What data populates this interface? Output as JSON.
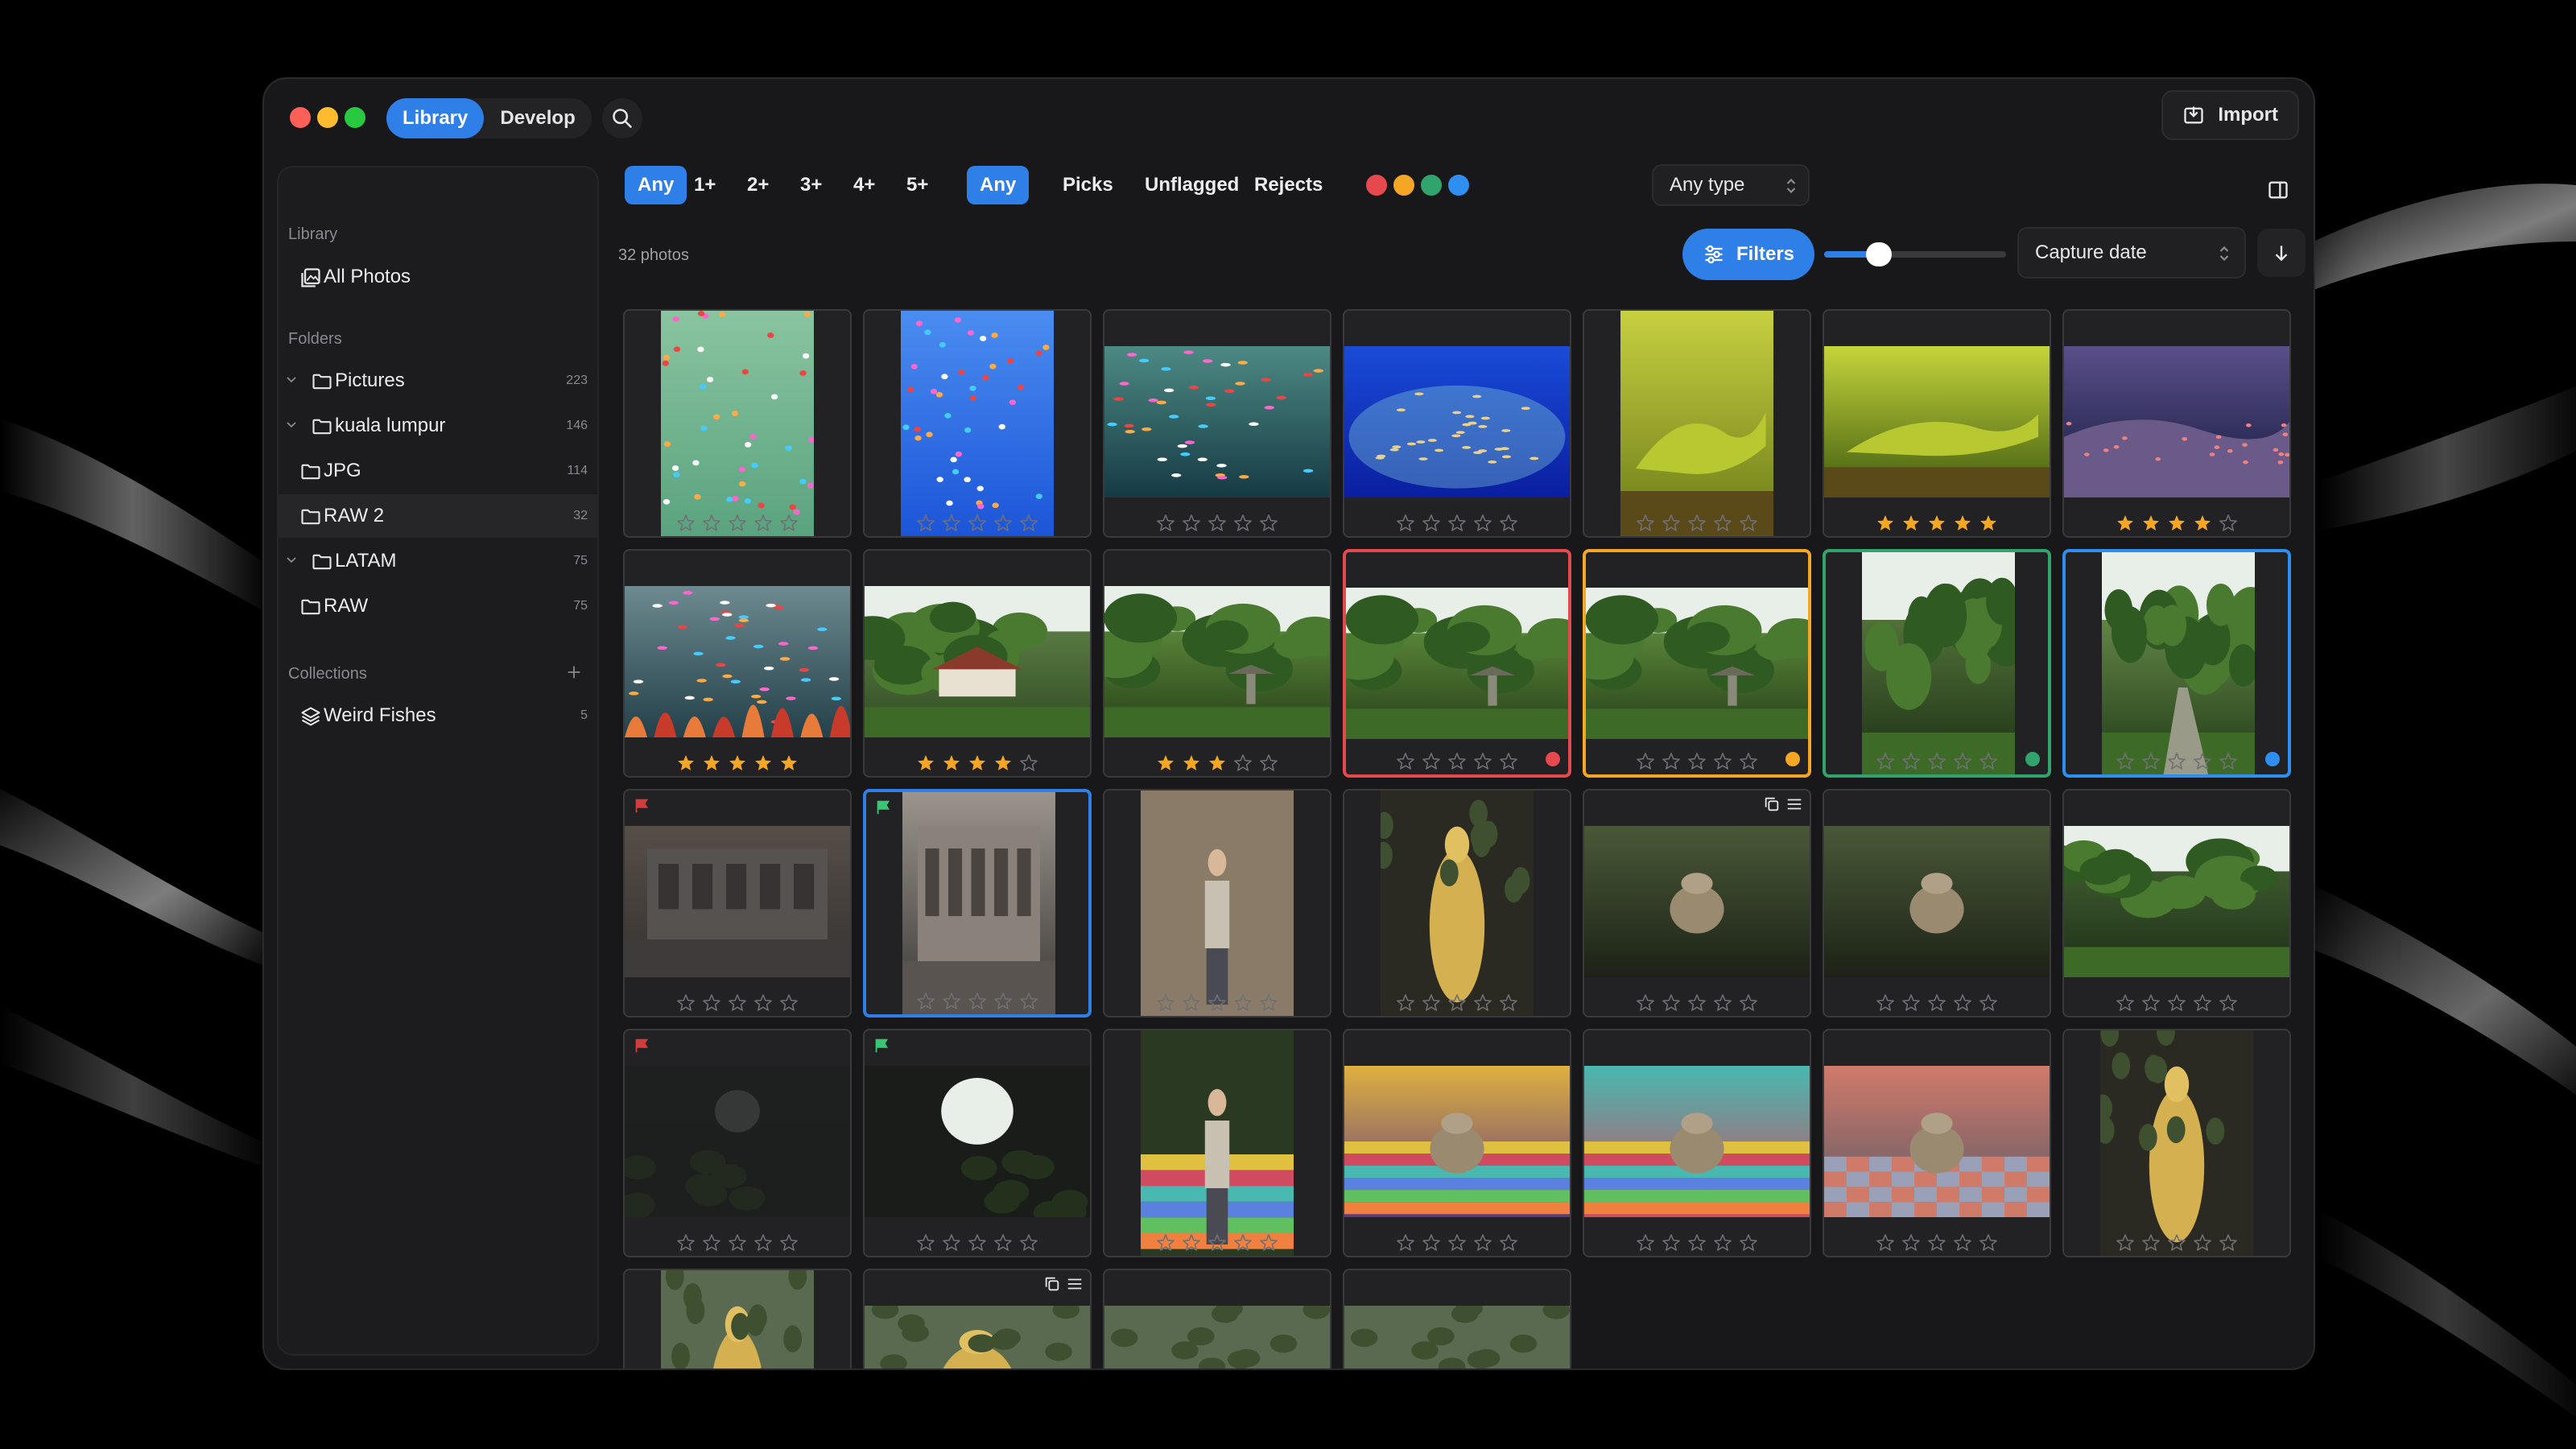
{
  "window": {
    "traffic_lights": [
      "#fe5f57",
      "#febc2e",
      "#28c840"
    ]
  },
  "mode_tabs": [
    {
      "label": "Library",
      "active": true
    },
    {
      "label": "Develop",
      "active": false
    }
  ],
  "header": {
    "import_label": "Import"
  },
  "sidebar": {
    "library_heading": "Library",
    "all_photos": "All Photos",
    "folders_heading": "Folders",
    "folders": [
      {
        "label": "Pictures",
        "count": "223",
        "expandable": true,
        "selected": false
      },
      {
        "label": "kuala lumpur",
        "count": "146",
        "expandable": true,
        "selected": false
      },
      {
        "label": "JPG",
        "count": "114",
        "expandable": false,
        "selected": false
      },
      {
        "label": "RAW 2",
        "count": "32",
        "expandable": false,
        "selected": true
      },
      {
        "label": "LATAM",
        "count": "75",
        "expandable": true,
        "selected": false
      },
      {
        "label": "RAW",
        "count": "75",
        "expandable": false,
        "selected": false
      }
    ],
    "collections_heading": "Collections",
    "collections": [
      {
        "label": "Weird Fishes",
        "count": "5"
      }
    ]
  },
  "rating_filters": [
    {
      "label": "Any",
      "active": true
    },
    {
      "label": "1+",
      "active": false
    },
    {
      "label": "2+",
      "active": false
    },
    {
      "label": "3+",
      "active": false
    },
    {
      "label": "4+",
      "active": false
    },
    {
      "label": "5+",
      "active": false
    }
  ],
  "flag_filters": [
    {
      "label": "Any",
      "active": true
    },
    {
      "label": "Picks",
      "active": false
    },
    {
      "label": "Unflagged",
      "active": false
    },
    {
      "label": "Rejects",
      "active": false
    }
  ],
  "color_filters": [
    "#e5484d",
    "#f5a623",
    "#30a46c",
    "#2f8ff0"
  ],
  "type_select": {
    "value": "Any type"
  },
  "photo_count": "32 photos",
  "filters_button": "Filters",
  "thumb_size": 0.3,
  "sort_select": {
    "value": "Capture date"
  },
  "colors": {
    "accent": "#2f7fe8",
    "star": "#f5a623",
    "red": "#e5484d",
    "orange": "#f5a623",
    "green": "#30a46c",
    "blue": "#2f8ff0",
    "pick": "#3bc473",
    "reject": "#d23c3c"
  },
  "photos": [
    {
      "scene": "fish-green",
      "shape": "portrait",
      "rating": 0
    },
    {
      "scene": "fish-blue",
      "shape": "portrait",
      "rating": 0
    },
    {
      "scene": "fish-tank",
      "shape": "landscape",
      "rating": 0
    },
    {
      "scene": "aquarium",
      "shape": "landscape",
      "rating": 0
    },
    {
      "scene": "lizard",
      "shape": "portrait",
      "rating": 0
    },
    {
      "scene": "lizard2",
      "shape": "landscape",
      "rating": 5
    },
    {
      "scene": "reef",
      "shape": "landscape",
      "rating": 4
    },
    {
      "scene": "reef-color",
      "shape": "landscape",
      "rating": 5
    },
    {
      "scene": "temple",
      "shape": "landscape",
      "rating": 4
    },
    {
      "scene": "garden",
      "shape": "landscape",
      "rating": 3
    },
    {
      "scene": "garden",
      "shape": "landscape",
      "rating": 0,
      "label": "red"
    },
    {
      "scene": "garden",
      "shape": "landscape",
      "rating": 0,
      "label": "orange"
    },
    {
      "scene": "forest",
      "shape": "portrait",
      "rating": 0,
      "label": "green"
    },
    {
      "scene": "forest-path",
      "shape": "portrait",
      "rating": 0,
      "label": "blue"
    },
    {
      "scene": "street",
      "shape": "landscape",
      "rating": 0,
      "flag": "reject"
    },
    {
      "scene": "building",
      "shape": "portrait",
      "rating": 0,
      "flag": "pick",
      "selected": true
    },
    {
      "scene": "person",
      "shape": "portrait",
      "rating": 0
    },
    {
      "scene": "statue",
      "shape": "portrait",
      "rating": 0
    },
    {
      "scene": "monkey",
      "shape": "landscape",
      "rating": 0,
      "badges": true
    },
    {
      "scene": "monkey",
      "shape": "landscape",
      "rating": 0
    },
    {
      "scene": "monkey-tree",
      "shape": "landscape",
      "rating": 0
    },
    {
      "scene": "cave",
      "shape": "landscape",
      "rating": 0,
      "flag": "reject"
    },
    {
      "scene": "cave-light",
      "shape": "landscape",
      "rating": 0,
      "flag": "pick"
    },
    {
      "scene": "stairs",
      "shape": "portrait",
      "rating": 0
    },
    {
      "scene": "monkey-stairs",
      "shape": "landscape",
      "rating": 0
    },
    {
      "scene": "monkey-stairs2",
      "shape": "landscape",
      "rating": 0
    },
    {
      "scene": "monkey-floor",
      "shape": "landscape",
      "rating": 0
    },
    {
      "scene": "golden-statue",
      "shape": "portrait",
      "rating": 0
    },
    {
      "scene": "cliff-statue",
      "shape": "portrait",
      "rating": 0
    },
    {
      "scene": "cliff-statue",
      "shape": "landscape",
      "rating": 0,
      "badges": true
    },
    {
      "scene": "cliff",
      "shape": "landscape",
      "rating": 0
    },
    {
      "scene": "cliff",
      "shape": "landscape",
      "rating": 0
    }
  ]
}
